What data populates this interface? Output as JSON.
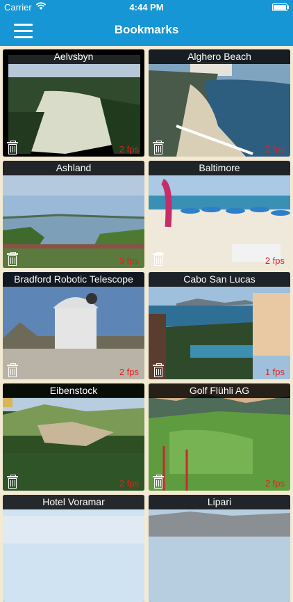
{
  "status": {
    "carrier": "Carrier",
    "time": "4:44 PM"
  },
  "nav": {
    "title": "Bookmarks"
  },
  "cams": [
    {
      "title": "Aelvsbyn",
      "fps": "2 fps"
    },
    {
      "title": "Alghero Beach",
      "fps": "2 fps"
    },
    {
      "title": "Ashland",
      "fps": "3 fps"
    },
    {
      "title": "Baltimore",
      "fps": "2 fps"
    },
    {
      "title": "Bradford Robotic Telescope",
      "fps": "2 fps"
    },
    {
      "title": "Cabo San Lucas",
      "fps": "1 fps"
    },
    {
      "title": "Eibenstock",
      "fps": "2 fps"
    },
    {
      "title": "Golf Flühli AG",
      "fps": "2 fps"
    },
    {
      "title": "Hotel Voramar",
      "fps": ""
    },
    {
      "title": "Lipari",
      "fps": ""
    }
  ]
}
